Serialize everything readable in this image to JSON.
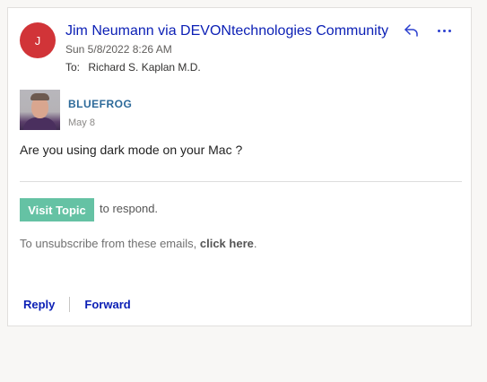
{
  "email": {
    "avatar_initial": "J",
    "avatar_color": "#d13438",
    "sender": "Jim Neumann via DEVONtechnologies Community",
    "date": "Sun 5/8/2022 8:26 AM",
    "to_label": "To:",
    "recipient": "Richard S. Kaplan M.D.",
    "header_icons": [
      "reply-icon",
      "more-options-icon"
    ]
  },
  "post": {
    "username": "BLUEFROG",
    "date": "May 8",
    "message": "Are you using dark mode on your Mac ?"
  },
  "footer": {
    "visit_button": "Visit Topic",
    "respond_text": "to respond.",
    "unsubscribe_prefix": "To unsubscribe from these emails, ",
    "unsubscribe_link": "click here",
    "unsubscribe_suffix": ".",
    "accent_color": "#65c2a4"
  },
  "actions": {
    "reply": "Reply",
    "forward": "Forward"
  },
  "colors": {
    "link_blue": "#0b1fb5",
    "username_blue": "#2d6a9a",
    "page_background": "#f8f7f5"
  }
}
